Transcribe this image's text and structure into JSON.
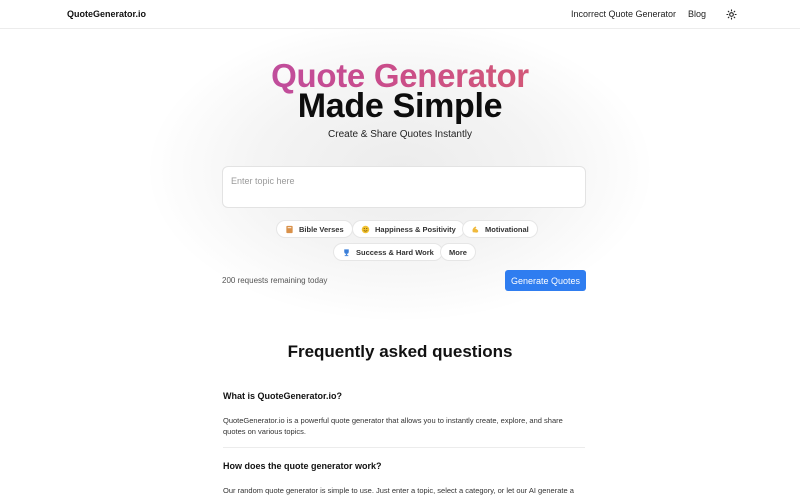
{
  "header": {
    "logo": "QuoteGenerator.io",
    "nav": [
      "Incorrect Quote Generator",
      "Blog"
    ],
    "theme_icon": "sun-icon"
  },
  "hero": {
    "title_line1": "Quote Generator",
    "title_line2": "Made Simple",
    "subtitle": "Create & Share Quotes Instantly",
    "gradient": [
      "#a855c7",
      "#c84b8e",
      "#e26b54"
    ]
  },
  "search": {
    "placeholder": "Enter topic here",
    "value": ""
  },
  "chips": [
    {
      "label": "Bible Verses",
      "icon": "book-icon",
      "color": "#b97a3c"
    },
    {
      "label": "Happiness & Positivity",
      "icon": "smile-icon",
      "color": "#e0a422"
    },
    {
      "label": "Motivational",
      "icon": "muscle-icon",
      "color": "#e8b53a"
    },
    {
      "label": "Success & Hard Work",
      "icon": "trophy-icon",
      "color": "#3b7fd9"
    },
    {
      "label": "More",
      "icon": "",
      "color": ""
    }
  ],
  "requests_remaining": "200 requests remaining today",
  "generate_button": "Generate Quotes",
  "accent_color": "#2f7df0",
  "faq": {
    "title": "Frequently asked questions",
    "items": [
      {
        "question": "What is QuoteGenerator.io?",
        "answer": "QuoteGenerator.io is a powerful quote generator that allows you to instantly create, explore, and share quotes on various topics."
      },
      {
        "question": "How does the quote generator work?",
        "answer": "Our random quote generator is simple to use. Just enter a topic, select a category, or let our AI generate a"
      }
    ]
  }
}
